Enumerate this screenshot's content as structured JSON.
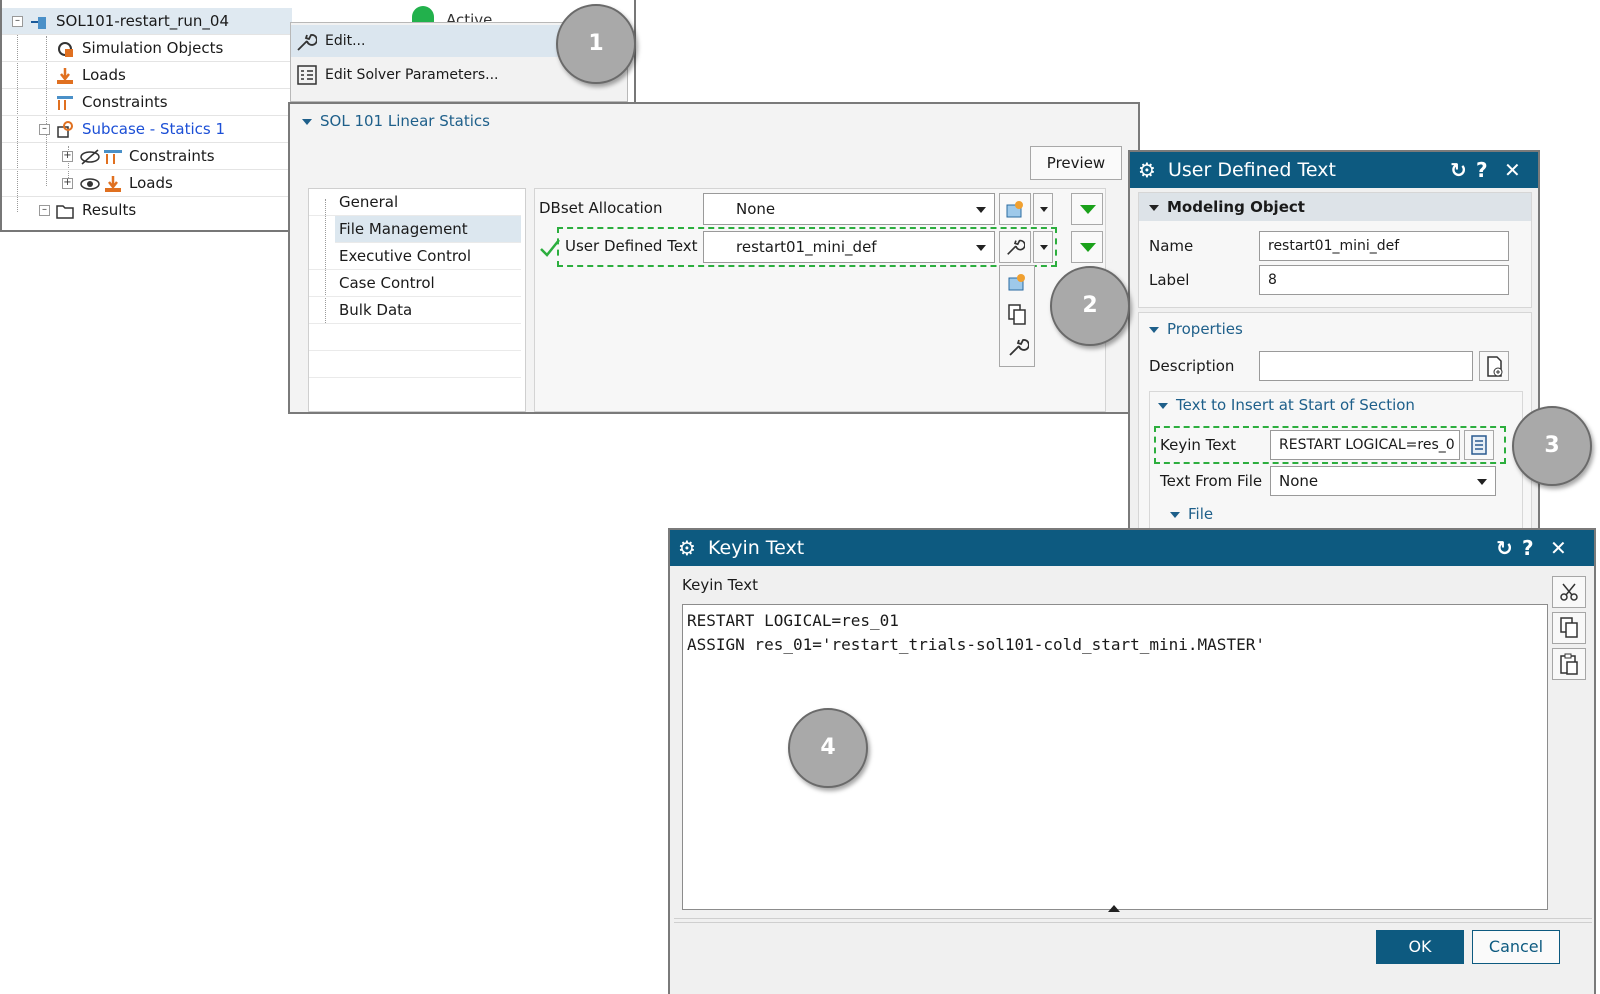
{
  "navigator": {
    "items": [
      {
        "label": "SOL101-restart_run_04",
        "status": "Active"
      },
      {
        "label": "Simulation Objects"
      },
      {
        "label": "Loads"
      },
      {
        "label": "Constraints"
      },
      {
        "label": "Subcase - Statics 1"
      },
      {
        "label": "Constraints"
      },
      {
        "label": "Loads"
      },
      {
        "label": "Results"
      }
    ],
    "status_color": "#22b14c",
    "subcase_color": "#1c4fd6"
  },
  "context_menu": {
    "items": [
      {
        "label": "Edit...",
        "icon": "wrench-icon"
      },
      {
        "label": "Edit Solver Parameters...",
        "icon": "parameter-list-icon"
      }
    ]
  },
  "sol_dialog": {
    "section_title": "SOL 101 Linear Statics",
    "preview_label": "Preview",
    "categories": [
      "General",
      "File Management",
      "Executive Control",
      "Case Control",
      "Bulk Data"
    ],
    "selected_category": "File Management",
    "dbset_label": "DBset Allocation",
    "dbset_value": "None",
    "udt_label": "User Defined Text",
    "udt_value": "restart01_mini_def",
    "highlight_color": "#2cae3e"
  },
  "udt_dialog": {
    "title": "User Defined Text",
    "modeling_object_header": "Modeling Object",
    "name_label": "Name",
    "name_value": "restart01_mini_def",
    "label_label": "Label",
    "label_value": "8",
    "properties_header": "Properties",
    "description_label": "Description",
    "description_value": "",
    "insert_header": "Text to Insert at Start of Section",
    "keyin_label": "Keyin Text",
    "keyin_value": "RESTART LOGICAL=res_0",
    "text_from_file_label": "Text From File",
    "text_from_file_value": "None",
    "file_header": "File",
    "titlebar_color": "#0d5a80"
  },
  "keyin_dialog": {
    "title": "Keyin Text",
    "field_label": "Keyin Text",
    "text": "RESTART LOGICAL=res_01\nASSIGN res_01='restart_trials-sol101-cold_start_mini.MASTER'",
    "ok_label": "OK",
    "cancel_label": "Cancel",
    "ok_color": "#0d5a80"
  },
  "callouts": [
    "1",
    "2",
    "3",
    "4"
  ]
}
